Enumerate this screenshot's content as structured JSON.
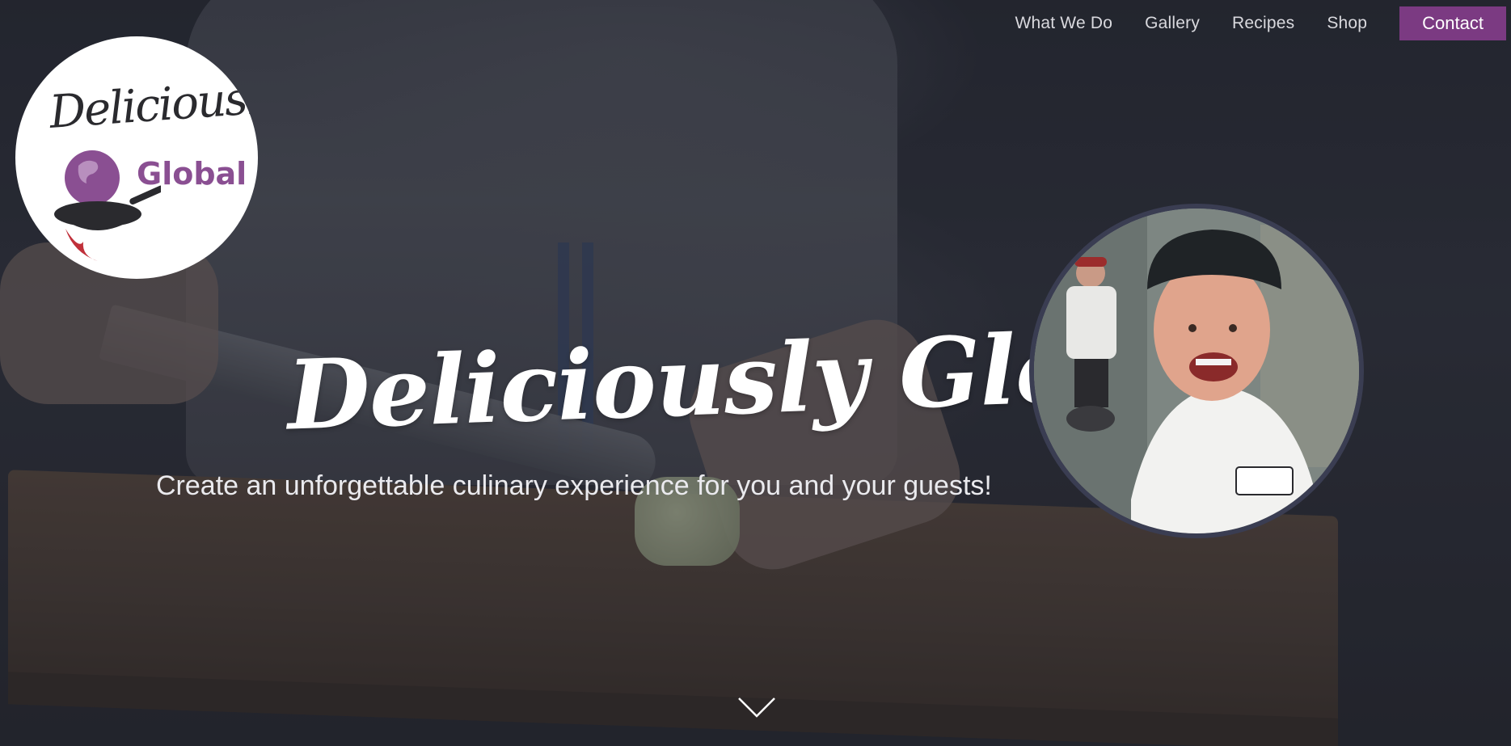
{
  "nav": {
    "items": [
      {
        "label": "What We Do"
      },
      {
        "label": "Gallery"
      },
      {
        "label": "Recipes"
      },
      {
        "label": "Shop"
      }
    ],
    "contact_label": "Contact"
  },
  "logo": {
    "script_text": "Deliciously",
    "global_text": "Global"
  },
  "hero": {
    "title": "Deliciously Global",
    "subtitle": "Create an unforgettable culinary experience for you and your guests!"
  },
  "colors": {
    "accent": "#7b3a82",
    "logo_purple": "#8a4f92",
    "logo_red": "#c0303a"
  },
  "icons": {
    "scroll": "chevron-down-icon"
  }
}
